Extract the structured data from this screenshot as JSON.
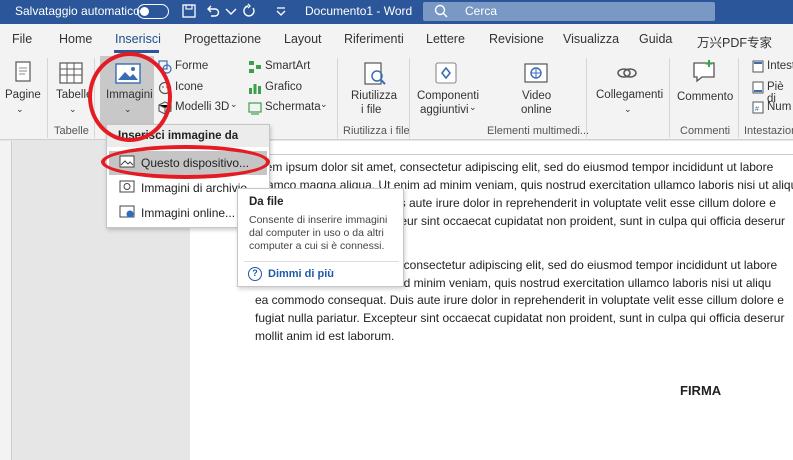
{
  "titlebar": {
    "autosave_label": "Salvataggio automatico",
    "toggle_state": "off",
    "document_title": "Documento1  -  Word",
    "search_placeholder": "Cerca"
  },
  "tabs": [
    "File",
    "Home",
    "Inserisci",
    "Progettazione",
    "Layout",
    "Riferimenti",
    "Lettere",
    "Revisione",
    "Visualizza",
    "Guida",
    "万兴PDF专家"
  ],
  "active_tab": "Inserisci",
  "ribbon": {
    "pagine": "Pagine",
    "tabelle": "Tabelle",
    "tabelle_group": "Tabelle",
    "immagini": "Immagini",
    "forme": "Forme",
    "icone": "Icone",
    "modelli3d": "Modelli 3D",
    "smartart": "SmartArt",
    "grafico": "Grafico",
    "schermata": "Schermata",
    "riutilizza_1": "Riutilizza",
    "riutilizza_2": "i file",
    "riutilizza_group": "Riutilizza i file",
    "componenti_1": "Componenti",
    "componenti_2": "aggiuntivi",
    "video_1": "Video",
    "video_2": "online",
    "elementi_group": "Elementi multimedi...",
    "collegamenti": "Collegamenti",
    "commento": "Commento",
    "commenti_group": "Commenti",
    "intest": "Intest",
    "pie": "Piè di",
    "num": "Num",
    "intestazione_group": "Intestazion"
  },
  "dropdown": {
    "header": "Inserisci immagine da",
    "items": [
      "Questo dispositivo...",
      "Immagini di archivio...",
      "Immagini online..."
    ]
  },
  "tooltip": {
    "title": "Da file",
    "body": "Consente di inserire immagini dal computer in uso o da altri computer a cui si è connessi.",
    "help": "Dimmi di più"
  },
  "document": {
    "lines": [
      "orem ipsum dolor sit amet, consectetur adipiscing elit, sed do eiusmod tempor incididunt ut labore",
      "ullamco magna aliqua. Ut enim ad minim veniam, quis nostrud exercitation ullamco laboris nisi ut aliqu",
      "is aute irure dolor in reprehenderit in voluptate velit esse cillum dolore e",
      "teur sint occaecat cupidatat non proident, sunt in culpa qui officia deserur",
      ", consectetur adipiscing elit, sed do eiusmod tempor incididunt ut labore",
      "ad minim veniam, quis nostrud exercitation ullamco laboris nisi ut aliqu",
      "ea commodo consequat. Duis aute irure dolor in reprehenderit in voluptate velit esse cillum dolore e",
      "fugiat nulla pariatur. Excepteur sint occaecat cupidatat non proident, sunt in culpa qui officia deserur",
      "mollit anim id est laborum."
    ],
    "signature": "FIRMA"
  }
}
